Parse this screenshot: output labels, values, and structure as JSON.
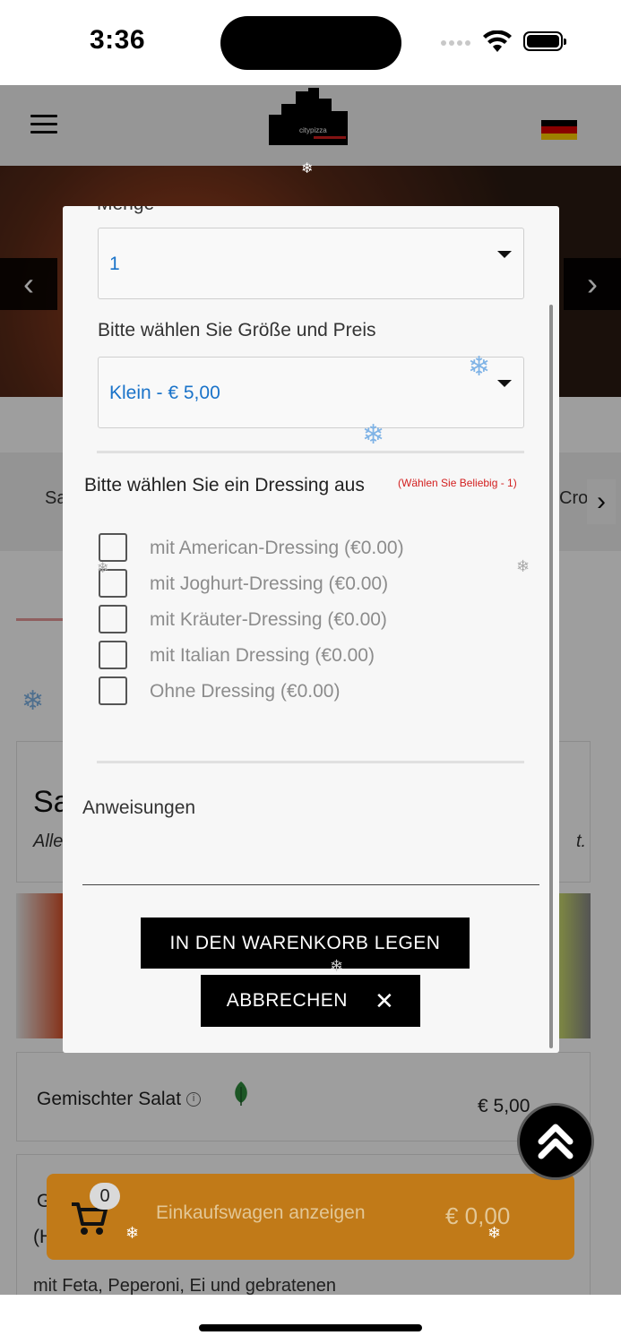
{
  "status_bar": {
    "time": "3:36"
  },
  "header": {
    "logo_text": "citypizza"
  },
  "hero": {
    "prev_icon": "chevron-left-icon",
    "next_icon": "chevron-right-icon"
  },
  "background": {
    "category_left": "Sa",
    "category_right": "Cro",
    "card_title": "Sa",
    "card_subtitle_start": "Alle",
    "card_subtitle_end": "t.",
    "item_name": "Gemischter Salat",
    "item_price": "€ 5,00",
    "item2_line1": "G",
    "item2_line2": "(H",
    "item2_desc": "mit Feta, Peperoni, Ei und gebratenen"
  },
  "modal": {
    "cut_label": "Menge",
    "quantity": {
      "value": "1"
    },
    "size_label": "Bitte wählen Sie Größe und Preis",
    "size": {
      "value": "Klein - € 5,00"
    },
    "dressing_label": "Bitte wählen Sie ein Dressing aus",
    "dressing_hint": "(Wählen Sie Beliebig - 1)",
    "dressing_options": [
      {
        "label": "mit American-Dressing (€0.00)",
        "checked": false
      },
      {
        "label": "mit Joghurt-Dressing (€0.00)",
        "checked": false
      },
      {
        "label": "mit Kräuter-Dressing (€0.00)",
        "checked": false
      },
      {
        "label": "mit Italian Dressing (€0.00)",
        "checked": false
      },
      {
        "label": "Ohne Dressing (€0.00)",
        "checked": false
      }
    ],
    "instructions_label": "Anweisungen",
    "instructions_value": "",
    "add_button": "IN DEN WARENKORB LEGEN",
    "cancel_button": "ABBRECHEN"
  },
  "cart": {
    "count": "0",
    "label": "Einkaufswagen anzeigen",
    "total": "€ 0,00"
  },
  "colors": {
    "cart_bar": "#c17a18",
    "link_blue": "#1a73c9",
    "hint_red": "#d32020"
  }
}
